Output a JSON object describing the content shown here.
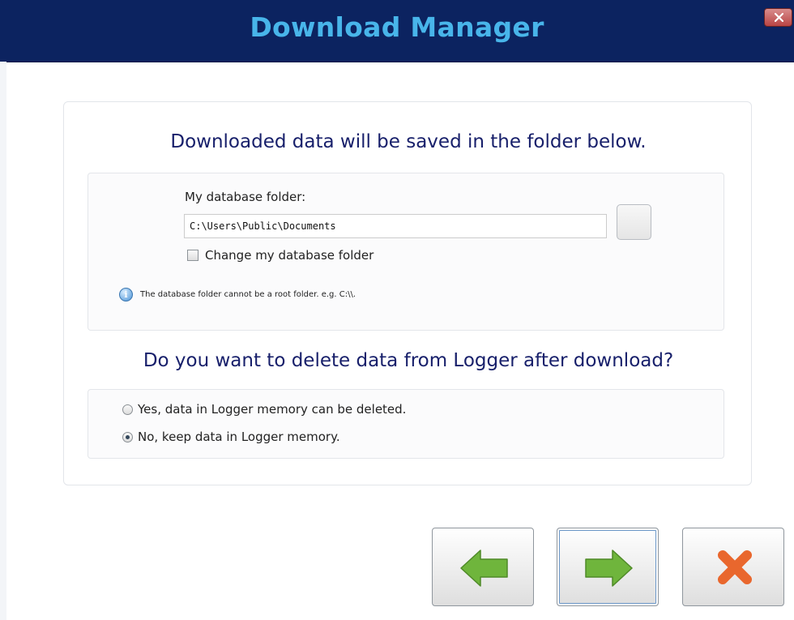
{
  "window": {
    "title": "Download Manager",
    "close_icon": "close-x-icon",
    "titlebar_color": "#0c2360",
    "title_color": "#48b5ea"
  },
  "folder_section": {
    "heading": "Downloaded data will be saved in the folder below.",
    "label": "My database folder:",
    "value": "C:\\Users\\Public\\Documents",
    "browse_icon": "browse-folder-icon",
    "change_checkbox_label": "Change my database folder",
    "change_checked": false,
    "info_text": "The database folder cannot be a root folder. e.g. C:\\\\.",
    "info_icon": "info-icon"
  },
  "delete_section": {
    "heading": "Do you want to delete data from Logger after download?",
    "options": [
      {
        "label": "Yes, data in Logger memory can be deleted.",
        "selected": false
      },
      {
        "label": "No, keep data in Logger memory.",
        "selected": true
      }
    ]
  },
  "buttons": {
    "back_icon": "left-arrow-icon",
    "next_icon": "right-arrow-icon",
    "cancel_icon": "cancel-x-icon",
    "arrow_color": "#6fb53c",
    "cancel_color": "#e9672d"
  }
}
